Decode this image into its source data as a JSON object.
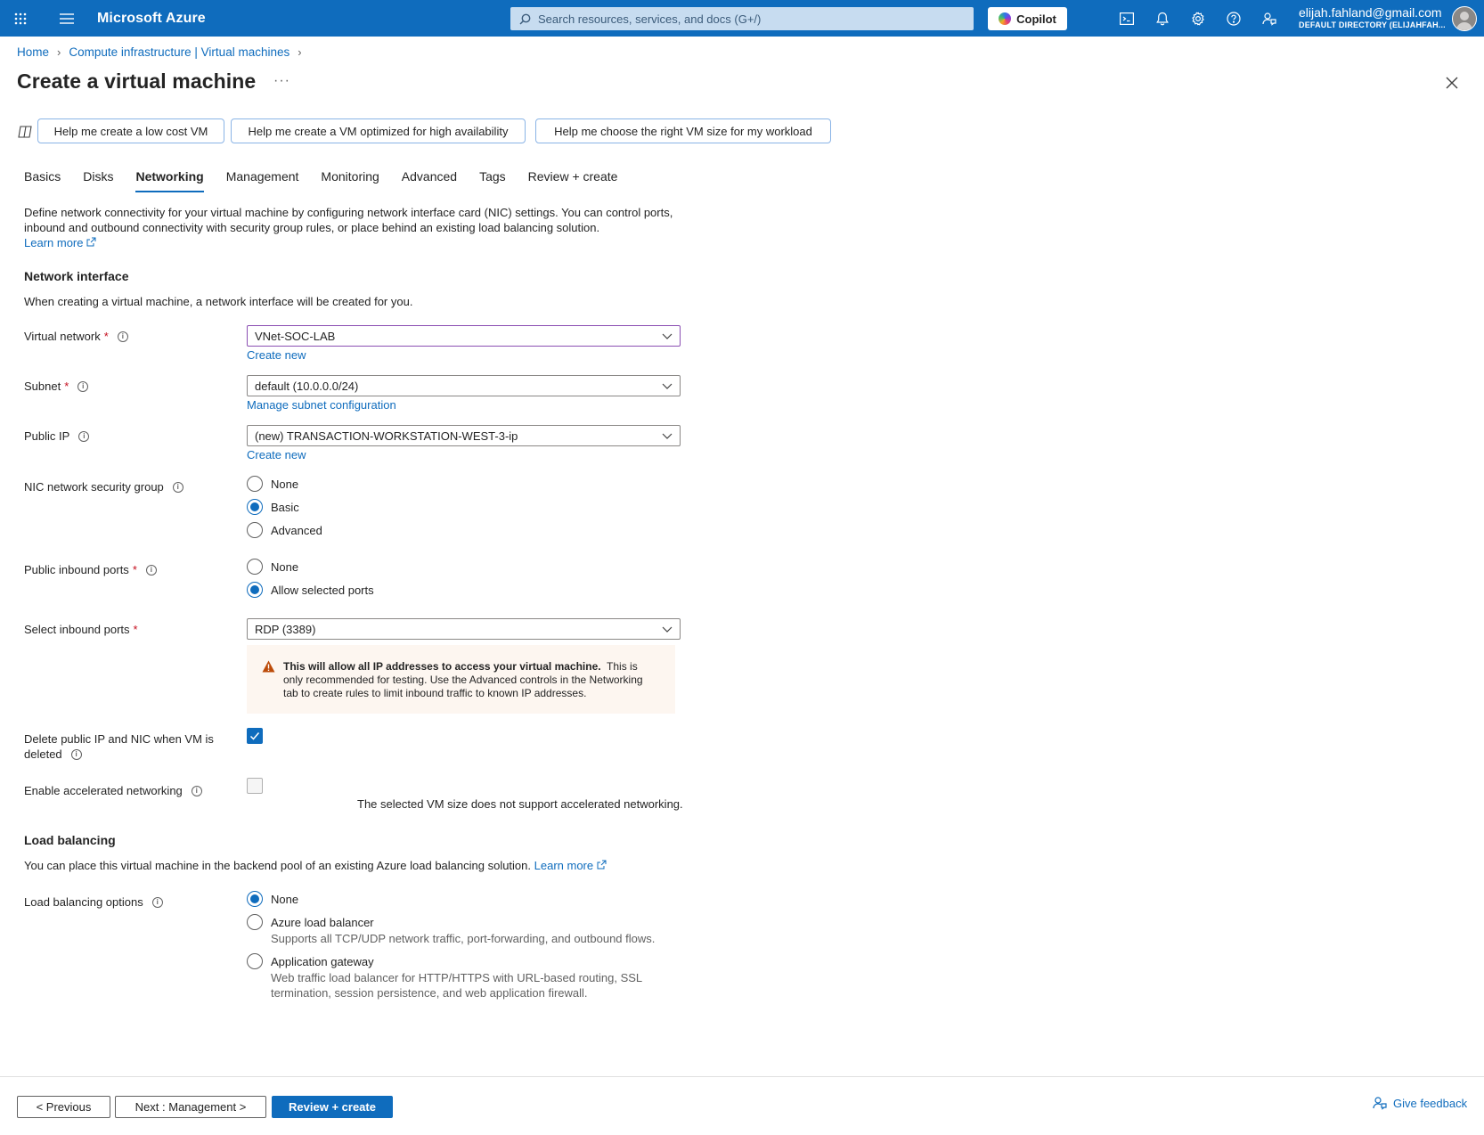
{
  "topbar": {
    "brand": "Microsoft Azure",
    "search_placeholder": "Search resources, services, and docs (G+/)",
    "copilot_label": "Copilot",
    "account_email": "elijah.fahland@gmail.com",
    "account_directory": "DEFAULT DIRECTORY (ELIJAHFAH..."
  },
  "breadcrumb": {
    "items": [
      "Home",
      "Compute infrastructure | Virtual machines"
    ]
  },
  "page": {
    "title": "Create a virtual machine",
    "more": "···"
  },
  "prompts": [
    "Help me create a low cost VM",
    "Help me create a VM optimized for high availability",
    "Help me choose the right VM size for my workload"
  ],
  "tabs": [
    "Basics",
    "Disks",
    "Networking",
    "Management",
    "Monitoring",
    "Advanced",
    "Tags",
    "Review + create"
  ],
  "active_tab": "Networking",
  "intro": {
    "line1": "Define network connectivity for your virtual machine by configuring network interface card (NIC) settings. You can control ports,",
    "line2": "inbound and outbound connectivity with security group rules, or place behind an existing load balancing solution.",
    "learn_more": "Learn more"
  },
  "network_interface": {
    "title": "Network interface",
    "description": "When creating a virtual machine, a network interface will be created for you.",
    "virtual_network": {
      "label": "Virtual network",
      "value": "VNet-SOC-LAB",
      "link": "Create new"
    },
    "subnet": {
      "label": "Subnet",
      "value": "default (10.0.0.0/24)",
      "link": "Manage subnet configuration"
    },
    "public_ip": {
      "label": "Public IP",
      "value": "(new) TRANSACTION-WORKSTATION-WEST-3-ip",
      "link": "Create new"
    },
    "nsg": {
      "label": "NIC network security group",
      "options": [
        "None",
        "Basic",
        "Advanced"
      ],
      "selected": "Basic"
    },
    "public_inbound": {
      "label": "Public inbound ports",
      "options": [
        "None",
        "Allow selected ports"
      ],
      "selected": "Allow selected ports"
    },
    "select_ports": {
      "label": "Select inbound ports",
      "value": "RDP (3389)"
    },
    "warning": {
      "bold": "This will allow all IP addresses to access your virtual machine.",
      "text": "This is only recommended for testing.  Use the Advanced controls in the Networking tab to create rules to limit inbound traffic to known IP addresses."
    },
    "delete_ip": {
      "label_line1": "Delete public IP and NIC when VM is",
      "label_line2": "deleted",
      "checked": true
    },
    "accelerated": {
      "label": "Enable accelerated networking",
      "checked": false,
      "note": "The selected VM size does not support accelerated networking."
    }
  },
  "load_balancing": {
    "title": "Load balancing",
    "description": "You can place this virtual machine in the backend pool of an existing Azure load balancing solution.",
    "learn_more": "Learn more",
    "label": "Load balancing options",
    "options": [
      {
        "label": "None",
        "desc": ""
      },
      {
        "label": "Azure load balancer",
        "desc": "Supports all TCP/UDP network traffic, port-forwarding, and outbound flows."
      },
      {
        "label": "Application gateway",
        "desc_line1": "Web traffic load balancer for HTTP/HTTPS with URL-based routing, SSL",
        "desc_line2": "termination, session persistence, and web application firewall."
      }
    ],
    "selected": "None"
  },
  "footer": {
    "previous": "< Previous",
    "next": "Next : Management >",
    "review": "Review + create",
    "feedback": "Give feedback"
  },
  "colors": {
    "accent": "#0f6cbd",
    "required": "#c50f1f",
    "warning": "#bc4b09"
  }
}
